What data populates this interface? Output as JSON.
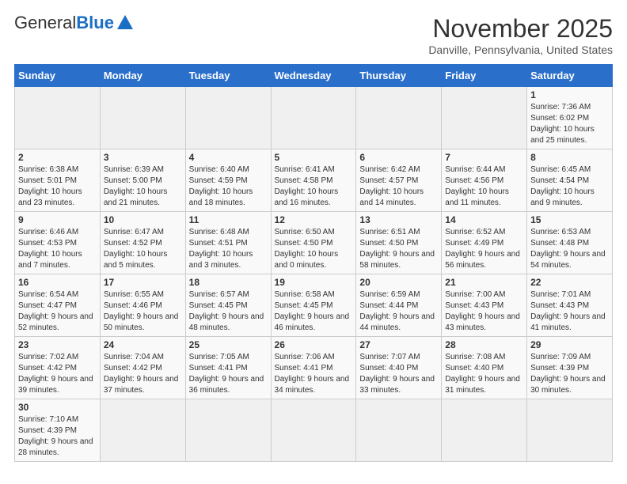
{
  "header": {
    "logo_general": "General",
    "logo_blue": "Blue",
    "month_title": "November 2025",
    "location": "Danville, Pennsylvania, United States"
  },
  "days_of_week": [
    "Sunday",
    "Monday",
    "Tuesday",
    "Wednesday",
    "Thursday",
    "Friday",
    "Saturday"
  ],
  "weeks": [
    [
      {
        "day": "",
        "info": ""
      },
      {
        "day": "",
        "info": ""
      },
      {
        "day": "",
        "info": ""
      },
      {
        "day": "",
        "info": ""
      },
      {
        "day": "",
        "info": ""
      },
      {
        "day": "",
        "info": ""
      },
      {
        "day": "1",
        "info": "Sunrise: 7:36 AM\nSunset: 6:02 PM\nDaylight: 10 hours and 25 minutes."
      }
    ],
    [
      {
        "day": "2",
        "info": "Sunrise: 6:38 AM\nSunset: 5:01 PM\nDaylight: 10 hours and 23 minutes."
      },
      {
        "day": "3",
        "info": "Sunrise: 6:39 AM\nSunset: 5:00 PM\nDaylight: 10 hours and 21 minutes."
      },
      {
        "day": "4",
        "info": "Sunrise: 6:40 AM\nSunset: 4:59 PM\nDaylight: 10 hours and 18 minutes."
      },
      {
        "day": "5",
        "info": "Sunrise: 6:41 AM\nSunset: 4:58 PM\nDaylight: 10 hours and 16 minutes."
      },
      {
        "day": "6",
        "info": "Sunrise: 6:42 AM\nSunset: 4:57 PM\nDaylight: 10 hours and 14 minutes."
      },
      {
        "day": "7",
        "info": "Sunrise: 6:44 AM\nSunset: 4:56 PM\nDaylight: 10 hours and 11 minutes."
      },
      {
        "day": "8",
        "info": "Sunrise: 6:45 AM\nSunset: 4:54 PM\nDaylight: 10 hours and 9 minutes."
      }
    ],
    [
      {
        "day": "9",
        "info": "Sunrise: 6:46 AM\nSunset: 4:53 PM\nDaylight: 10 hours and 7 minutes."
      },
      {
        "day": "10",
        "info": "Sunrise: 6:47 AM\nSunset: 4:52 PM\nDaylight: 10 hours and 5 minutes."
      },
      {
        "day": "11",
        "info": "Sunrise: 6:48 AM\nSunset: 4:51 PM\nDaylight: 10 hours and 3 minutes."
      },
      {
        "day": "12",
        "info": "Sunrise: 6:50 AM\nSunset: 4:50 PM\nDaylight: 10 hours and 0 minutes."
      },
      {
        "day": "13",
        "info": "Sunrise: 6:51 AM\nSunset: 4:50 PM\nDaylight: 9 hours and 58 minutes."
      },
      {
        "day": "14",
        "info": "Sunrise: 6:52 AM\nSunset: 4:49 PM\nDaylight: 9 hours and 56 minutes."
      },
      {
        "day": "15",
        "info": "Sunrise: 6:53 AM\nSunset: 4:48 PM\nDaylight: 9 hours and 54 minutes."
      }
    ],
    [
      {
        "day": "16",
        "info": "Sunrise: 6:54 AM\nSunset: 4:47 PM\nDaylight: 9 hours and 52 minutes."
      },
      {
        "day": "17",
        "info": "Sunrise: 6:55 AM\nSunset: 4:46 PM\nDaylight: 9 hours and 50 minutes."
      },
      {
        "day": "18",
        "info": "Sunrise: 6:57 AM\nSunset: 4:45 PM\nDaylight: 9 hours and 48 minutes."
      },
      {
        "day": "19",
        "info": "Sunrise: 6:58 AM\nSunset: 4:45 PM\nDaylight: 9 hours and 46 minutes."
      },
      {
        "day": "20",
        "info": "Sunrise: 6:59 AM\nSunset: 4:44 PM\nDaylight: 9 hours and 44 minutes."
      },
      {
        "day": "21",
        "info": "Sunrise: 7:00 AM\nSunset: 4:43 PM\nDaylight: 9 hours and 43 minutes."
      },
      {
        "day": "22",
        "info": "Sunrise: 7:01 AM\nSunset: 4:43 PM\nDaylight: 9 hours and 41 minutes."
      }
    ],
    [
      {
        "day": "23",
        "info": "Sunrise: 7:02 AM\nSunset: 4:42 PM\nDaylight: 9 hours and 39 minutes."
      },
      {
        "day": "24",
        "info": "Sunrise: 7:04 AM\nSunset: 4:42 PM\nDaylight: 9 hours and 37 minutes."
      },
      {
        "day": "25",
        "info": "Sunrise: 7:05 AM\nSunset: 4:41 PM\nDaylight: 9 hours and 36 minutes."
      },
      {
        "day": "26",
        "info": "Sunrise: 7:06 AM\nSunset: 4:41 PM\nDaylight: 9 hours and 34 minutes."
      },
      {
        "day": "27",
        "info": "Sunrise: 7:07 AM\nSunset: 4:40 PM\nDaylight: 9 hours and 33 minutes."
      },
      {
        "day": "28",
        "info": "Sunrise: 7:08 AM\nSunset: 4:40 PM\nDaylight: 9 hours and 31 minutes."
      },
      {
        "day": "29",
        "info": "Sunrise: 7:09 AM\nSunset: 4:39 PM\nDaylight: 9 hours and 30 minutes."
      }
    ],
    [
      {
        "day": "30",
        "info": "Sunrise: 7:10 AM\nSunset: 4:39 PM\nDaylight: 9 hours and 28 minutes."
      },
      {
        "day": "",
        "info": ""
      },
      {
        "day": "",
        "info": ""
      },
      {
        "day": "",
        "info": ""
      },
      {
        "day": "",
        "info": ""
      },
      {
        "day": "",
        "info": ""
      },
      {
        "day": "",
        "info": ""
      }
    ]
  ]
}
